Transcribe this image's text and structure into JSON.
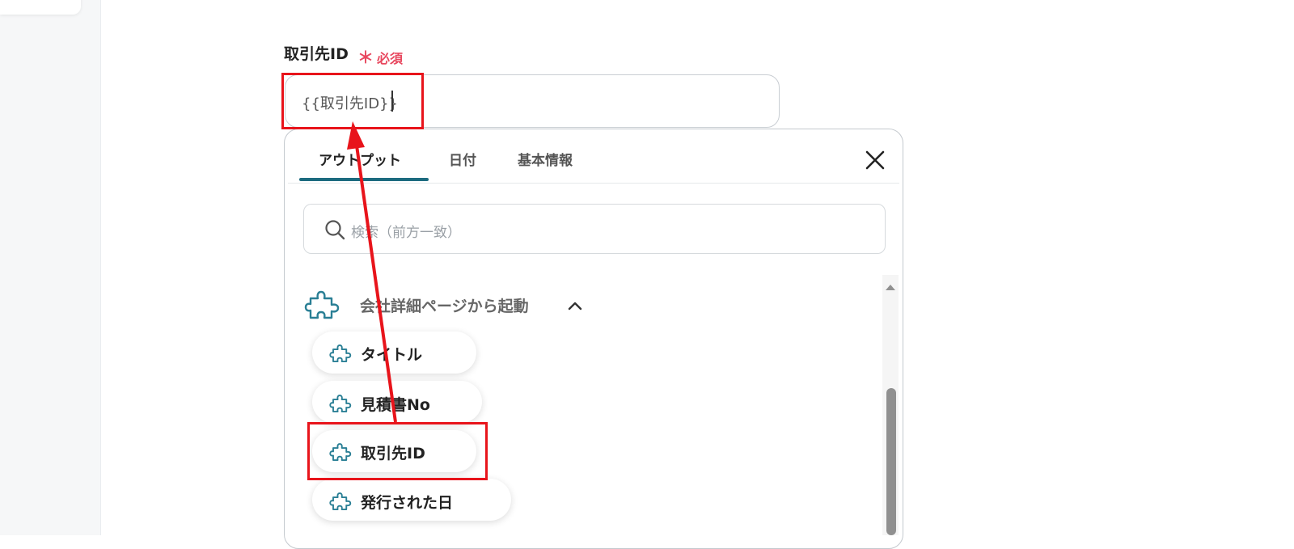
{
  "field": {
    "label": "取引先ID",
    "required_mark": "＊",
    "required_text": "必須",
    "value": "{{取引先ID}}"
  },
  "popup": {
    "tabs": [
      {
        "label": "アウトプット",
        "active": true
      },
      {
        "label": "日付",
        "active": false
      },
      {
        "label": "基本情報",
        "active": false
      }
    ],
    "search_placeholder": "検索（前方一致）",
    "group": {
      "label": "会社詳細ページから起動",
      "expanded": true,
      "items": [
        {
          "label": "タイトル"
        },
        {
          "label": "見積書No"
        },
        {
          "label": "取引先ID"
        },
        {
          "label": "発行された日"
        }
      ]
    }
  },
  "annotation": {
    "color": "#e8141b",
    "highlighted_item": "取引先ID"
  },
  "colors": {
    "accent": "#1c6b7f",
    "required": "#e8485f",
    "icon": "#2a7f95"
  },
  "icons": [
    "close-icon",
    "search-icon",
    "puzzle-icon",
    "chevron-up-icon",
    "scroll-up-icon"
  ]
}
